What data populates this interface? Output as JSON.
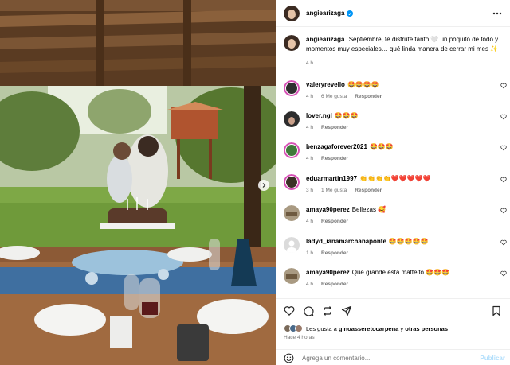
{
  "post": {
    "username": "angiearizaga",
    "verified": true,
    "caption": "Septiembre, te disfruté tanto 🤍 un poquito de todo y momentos muy especiales… qué linda manera de cerrar mi mes ✨",
    "caption_time": "4 h",
    "image_alt": "Mujer con niño en brazos frente a una torta de cumpleaños con velas en una terraza con vista al jardín"
  },
  "comments": [
    {
      "user": "valeryrevello",
      "text": "🤩🤩🤩🤩",
      "time": "4 h",
      "likes": "6 Me gusta",
      "reply": "Responder"
    },
    {
      "user": "lover.ngl",
      "text": "🤩🤩🤩",
      "time": "4 h",
      "likes": "",
      "reply": "Responder"
    },
    {
      "user": "benzagaforever2021",
      "text": "🤩🤩🤩",
      "time": "4 h",
      "likes": "",
      "reply": "Responder"
    },
    {
      "user": "eduarmartin1997",
      "text": "👏👏👏👏❤️❤️❤️❤️❤️",
      "time": "3 h",
      "likes": "1 Me gusta",
      "reply": "Responder"
    },
    {
      "user": "amaya90perez",
      "text": "Bellezas 🥰",
      "time": "4 h",
      "likes": "",
      "reply": "Responder"
    },
    {
      "user": "ladyd_ianamarchanaponte",
      "text": "🤩🤩🤩🤩🤩",
      "time": "1 h",
      "likes": "",
      "reply": "Responder"
    },
    {
      "user": "amaya90perez",
      "text": "Que grande está matteito 🤩🤩🤩",
      "time": "4 h",
      "likes": "",
      "reply": "Responder"
    }
  ],
  "likes": {
    "prefix": "Les gusta a ",
    "first": "ginoasseretocarpena",
    "middle": " y ",
    "others": "otras personas"
  },
  "time_ago": "Hace 4 horas",
  "add_comment": {
    "placeholder": "Agrega un comentario...",
    "publish": "Publicar"
  },
  "colors": {
    "verified": "#0095f6",
    "meta": "#737373",
    "publish": "#b2dffc",
    "divider": "#efefef"
  },
  "icons": [
    "more-icon",
    "heart-icon",
    "comment-icon",
    "share-icon",
    "bookmark-icon",
    "emoji-icon",
    "next-icon",
    "verified-icon"
  ]
}
